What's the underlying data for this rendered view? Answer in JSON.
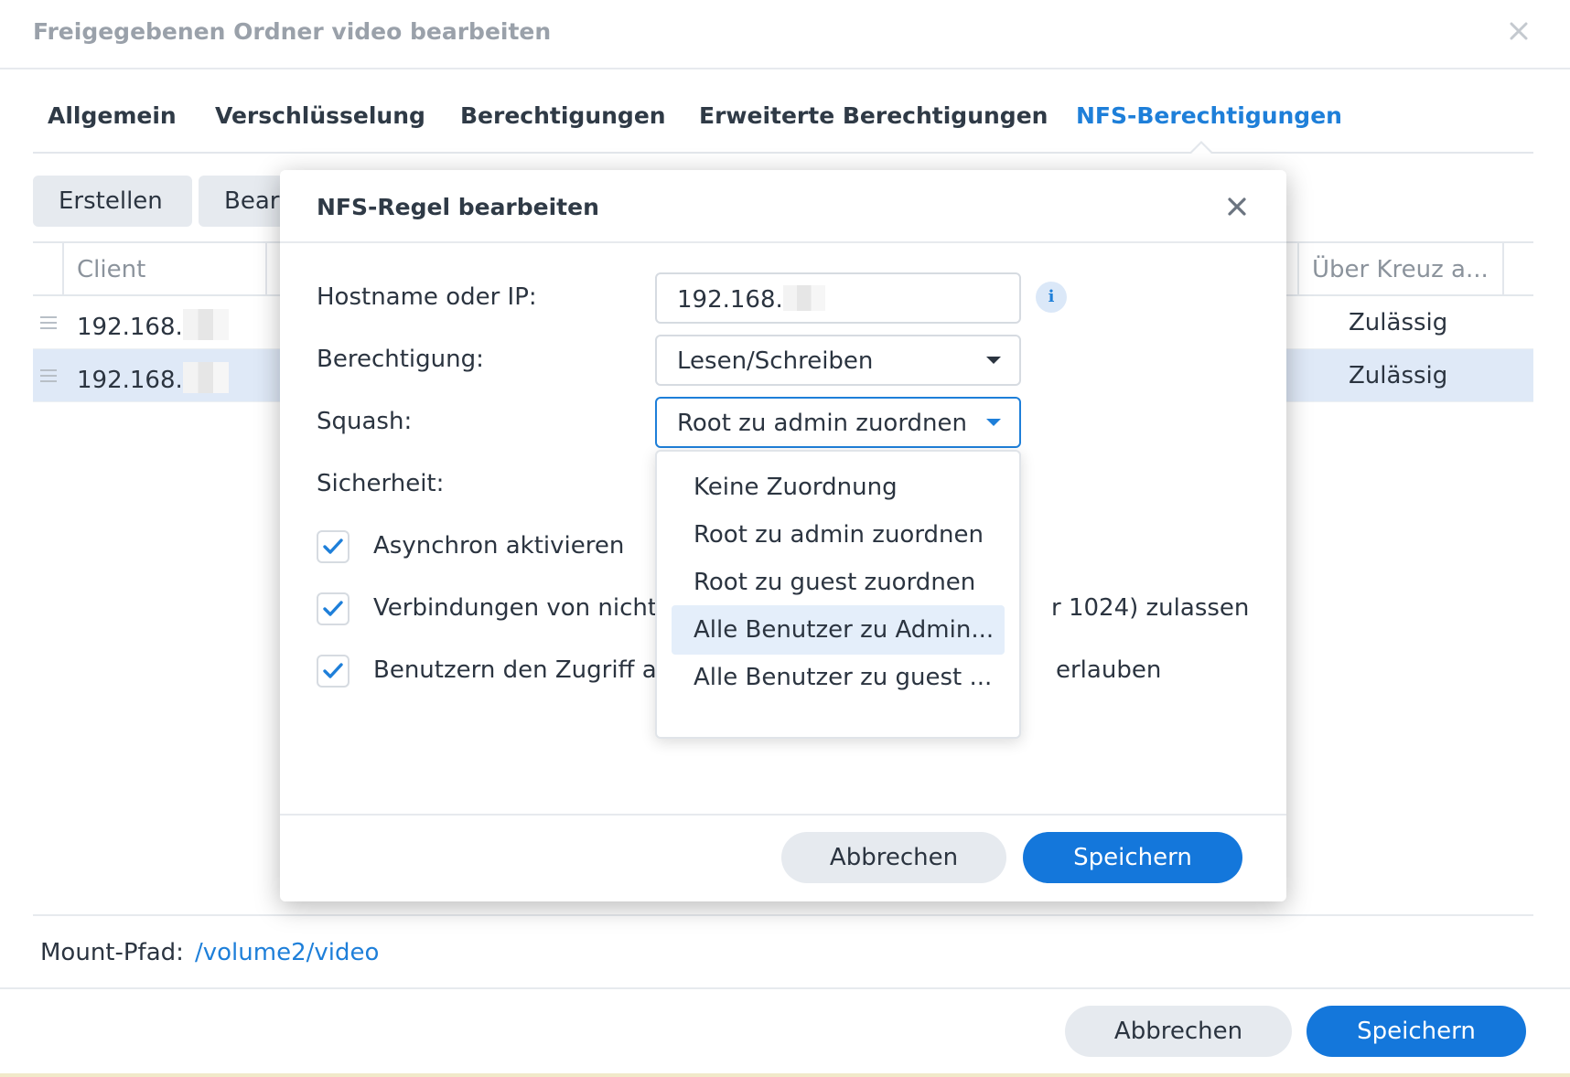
{
  "window": {
    "title": "Freigegebenen Ordner video bearbeiten"
  },
  "tabs": [
    {
      "label": "Allgemein"
    },
    {
      "label": "Verschlüsselung"
    },
    {
      "label": "Berechtigungen"
    },
    {
      "label": "Erweiterte Berechtigungen"
    },
    {
      "label": "NFS-Berechtigungen",
      "active": true
    }
  ],
  "toolbar": {
    "create_label": "Erstellen",
    "edit_label": "Bear"
  },
  "grid": {
    "columns": [
      "Client",
      "Über Kreuz a..."
    ],
    "rows": [
      {
        "client": "192.168.",
        "cross": "Zulässig",
        "selected": false
      },
      {
        "client": "192.168.",
        "cross": "Zulässig",
        "selected": true
      }
    ]
  },
  "mount": {
    "label": "Mount-Pfad:",
    "path": "/volume2/video"
  },
  "footer": {
    "cancel_label": "Abbrechen",
    "save_label": "Speichern"
  },
  "modal": {
    "title": "NFS-Regel bearbeiten",
    "hostname_label": "Hostname oder IP:",
    "hostname_value": "192.168.",
    "permission_label": "Berechtigung:",
    "permission_value": "Lesen/Schreiben",
    "squash_label": "Squash:",
    "squash_value": "Root zu admin zuordnen",
    "security_label": "Sicherheit:",
    "checkboxes": [
      {
        "label": "Asynchron aktivieren",
        "checked": true
      },
      {
        "label": "Verbindungen von nicht-",
        "tail": "r 1024) zulassen",
        "checked": true
      },
      {
        "label": "Benutzern den Zugriff a",
        "tail": "erlauben",
        "checked": true
      }
    ],
    "squash_options": [
      {
        "label": "Keine Zuordnung"
      },
      {
        "label": "Root zu admin zuordnen"
      },
      {
        "label": "Root zu guest zuordnen"
      },
      {
        "label": "Alle Benutzer zu Admin...",
        "hover": true
      },
      {
        "label": "Alle Benutzer zu guest ..."
      }
    ],
    "cancel_label": "Abbrechen",
    "save_label": "Speichern"
  },
  "colors": {
    "accent": "#1e7fd9",
    "primary_button": "#1477db",
    "selected_row": "#dfe9f7"
  }
}
